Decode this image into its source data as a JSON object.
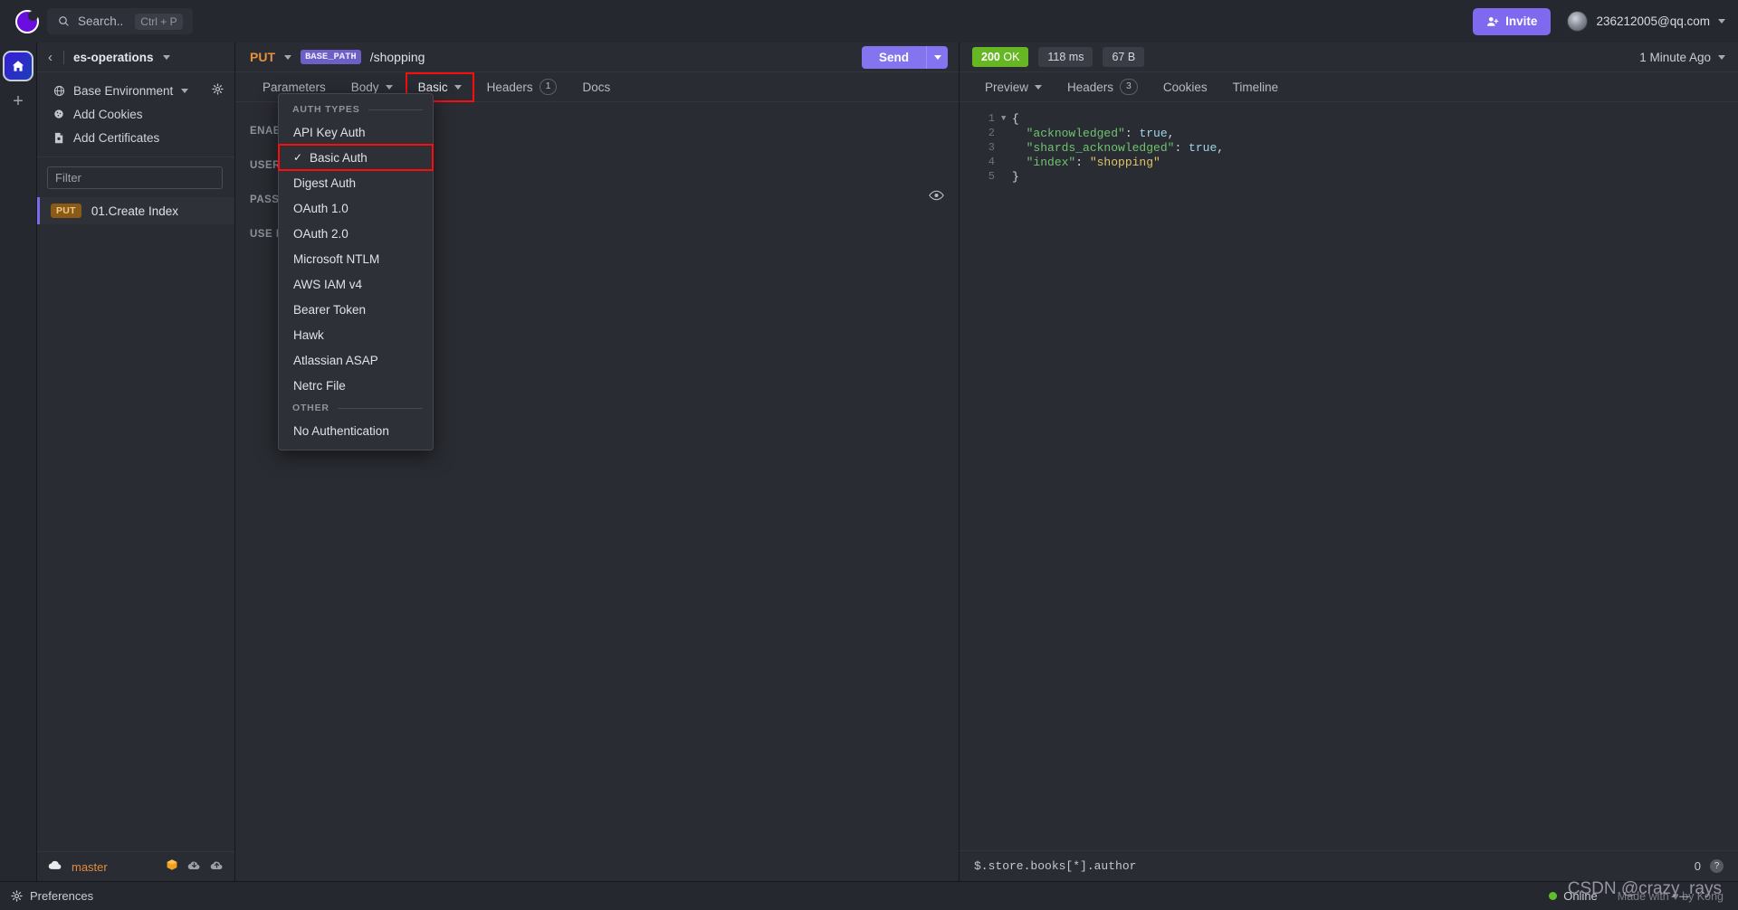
{
  "topbar": {
    "search_label": "Search..",
    "search_shortcut": "Ctrl + P",
    "invite_label": "Invite",
    "account_email": "236212005@qq.com"
  },
  "sidebar": {
    "workspace": "es-operations",
    "env_label": "Base Environment",
    "items": [
      {
        "label": "Base Environment",
        "icon": "globe-icon"
      },
      {
        "label": "Add Cookies",
        "icon": "cookie-icon"
      },
      {
        "label": "Add Certificates",
        "icon": "certificate-icon"
      }
    ],
    "filter_placeholder": "Filter",
    "requests": [
      {
        "method": "PUT",
        "name": "01.Create Index"
      }
    ],
    "branch": "master"
  },
  "request": {
    "method": "PUT",
    "env_chip": "BASE_PATH",
    "path": "/shopping",
    "send_label": "Send",
    "tabs": [
      {
        "label": "Parameters",
        "caret": false,
        "badge": ""
      },
      {
        "label": "Body",
        "caret": true,
        "badge": ""
      },
      {
        "label": "Basic",
        "caret": true,
        "badge": ""
      },
      {
        "label": "Headers",
        "caret": false,
        "badge": "1"
      },
      {
        "label": "Docs",
        "caret": false,
        "badge": ""
      }
    ],
    "auth_form": [
      {
        "label": "ENABLED"
      },
      {
        "label": "USERNAME"
      },
      {
        "label": "PASSWORD"
      },
      {
        "label": "USE ISO 8859-1"
      }
    ]
  },
  "auth_menu": {
    "section_auth_types": "AUTH TYPES",
    "section_other": "OTHER",
    "selected": "Basic Auth",
    "items": [
      "API Key Auth",
      "Basic Auth",
      "Digest Auth",
      "OAuth 1.0",
      "OAuth 2.0",
      "Microsoft NTLM",
      "AWS IAM v4",
      "Bearer Token",
      "Hawk",
      "Atlassian ASAP",
      "Netrc File"
    ],
    "other_items": [
      "No Authentication"
    ]
  },
  "response": {
    "status_code": "200",
    "status_text": "OK",
    "time": "118 ms",
    "size": "67 B",
    "time_ago": "1 Minute Ago",
    "tabs": [
      {
        "label": "Preview",
        "caret": true,
        "badge": ""
      },
      {
        "label": "Headers",
        "caret": false,
        "badge": "3"
      },
      {
        "label": "Cookies",
        "caret": false,
        "badge": ""
      },
      {
        "label": "Timeline",
        "caret": false,
        "badge": ""
      }
    ],
    "body_lines": [
      {
        "n": "1",
        "fold": true,
        "parts": [
          {
            "t": "{",
            "c": "p"
          }
        ]
      },
      {
        "n": "2",
        "fold": false,
        "parts": [
          {
            "t": "  ",
            "c": "p"
          },
          {
            "t": "\"acknowledged\"",
            "c": "k"
          },
          {
            "t": ": ",
            "c": "p"
          },
          {
            "t": "true",
            "c": "b"
          },
          {
            "t": ",",
            "c": "p"
          }
        ]
      },
      {
        "n": "3",
        "fold": false,
        "parts": [
          {
            "t": "  ",
            "c": "p"
          },
          {
            "t": "\"shards_acknowledged\"",
            "c": "k"
          },
          {
            "t": ": ",
            "c": "p"
          },
          {
            "t": "true",
            "c": "b"
          },
          {
            "t": ",",
            "c": "p"
          }
        ]
      },
      {
        "n": "4",
        "fold": false,
        "parts": [
          {
            "t": "  ",
            "c": "p"
          },
          {
            "t": "\"index\"",
            "c": "k"
          },
          {
            "t": ": ",
            "c": "p"
          },
          {
            "t": "\"shopping\"",
            "c": "s"
          }
        ]
      },
      {
        "n": "5",
        "fold": false,
        "parts": [
          {
            "t": "}",
            "c": "p"
          }
        ]
      }
    ],
    "filter_query": "$.store.books[*].author",
    "filter_count": "0"
  },
  "statusbar": {
    "preferences": "Preferences",
    "online": "Online",
    "made_with": "Made with ♥ by Kong",
    "watermark": "CSDN @crazy_rays"
  },
  "colors": {
    "accent_purple": "#8574f0",
    "status_green": "#66b723",
    "method_orange": "#e8913c",
    "highlight_red": "#fb0d0d"
  }
}
